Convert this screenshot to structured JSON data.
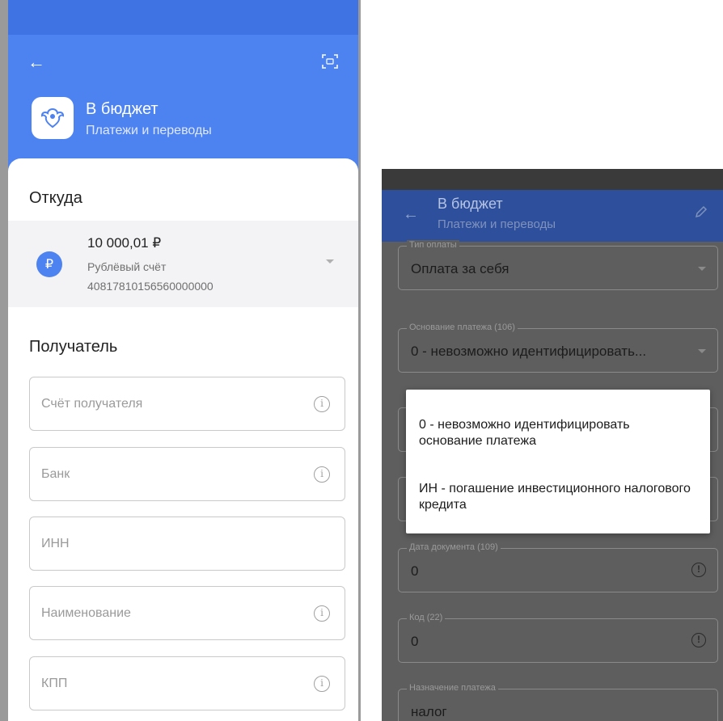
{
  "left": {
    "header": {
      "title": "В бюджет",
      "subtitle": "Платежи и переводы"
    },
    "from": {
      "section_title": "Откуда",
      "amount": "10 000,01 ₽",
      "account_name": "Рублёвый счёт",
      "account_number": "40817810156560000000"
    },
    "recipient": {
      "section_title": "Получатель",
      "fields": [
        {
          "placeholder": "Счёт получателя",
          "has_info": true
        },
        {
          "placeholder": "Банк",
          "has_info": true
        },
        {
          "placeholder": "ИНН",
          "has_info": false
        },
        {
          "placeholder": "Наименование",
          "has_info": true
        },
        {
          "placeholder": "КПП",
          "has_info": true
        }
      ]
    }
  },
  "right": {
    "header": {
      "title": "В бюджет",
      "subtitle": "Платежи и переводы"
    },
    "fields": {
      "payment_type": {
        "label": "Тип оплаты",
        "value": "Оплата за себя"
      },
      "payment_basis": {
        "label": "Основание платежа (106)",
        "value": "0 - невозможно идентифицировать..."
      },
      "doc_date": {
        "label": "Дата документа (109)",
        "value": "0"
      },
      "code": {
        "label": "Код (22)",
        "value": "0"
      },
      "purpose": {
        "label": "Назначение платежа",
        "value": "налог"
      }
    },
    "popup": {
      "options": [
        "0 - невозможно идентифицировать основание платежа",
        "ИН - погашение инвестиционного налогового кредита"
      ]
    }
  },
  "colors": {
    "primary": "#4d82f1",
    "status_bar": "#3f72e3",
    "dimmed_header": "#2d4f9c",
    "overlay": "#5e5e5e"
  }
}
